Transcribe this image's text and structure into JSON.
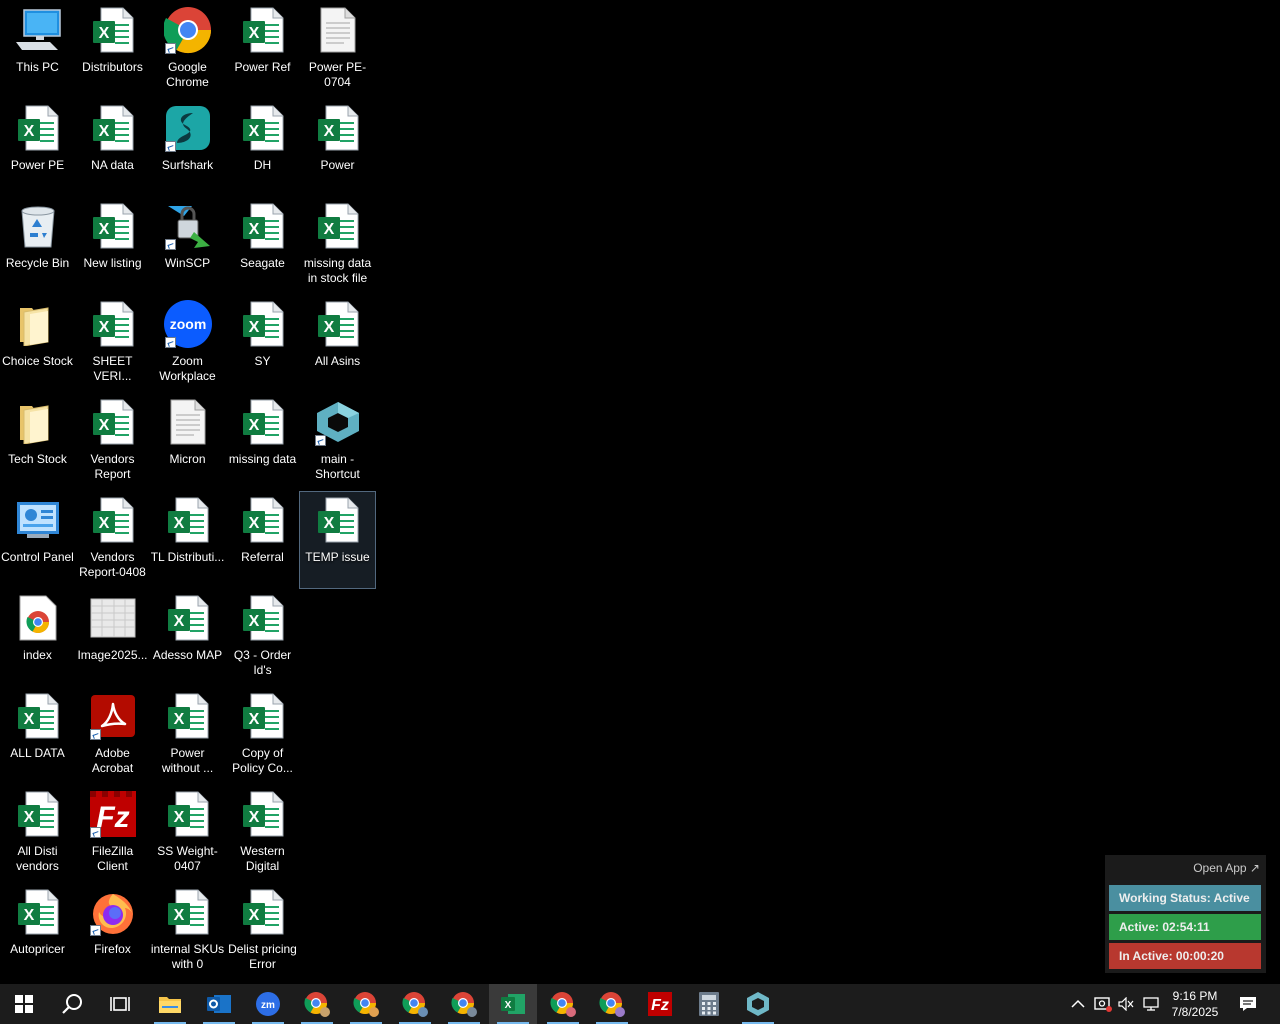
{
  "desktop": {
    "icons": [
      {
        "label": "This PC",
        "type": "pc",
        "shortcut": false
      },
      {
        "label": "Power PE",
        "type": "excel",
        "shortcut": false
      },
      {
        "label": "Recycle Bin",
        "type": "recycle",
        "shortcut": false
      },
      {
        "label": "Choice Stock",
        "type": "folder",
        "shortcut": false
      },
      {
        "label": "Tech Stock",
        "type": "folder",
        "shortcut": false
      },
      {
        "label": "Control Panel",
        "type": "control",
        "shortcut": false
      },
      {
        "label": "index",
        "type": "chromedoc",
        "shortcut": false
      },
      {
        "label": "ALL DATA",
        "type": "excel",
        "shortcut": false
      },
      {
        "label": "All Disti vendors",
        "type": "excel",
        "shortcut": false
      },
      {
        "label": "Autopricer",
        "type": "excel",
        "shortcut": false
      },
      {
        "label": "Distributors",
        "type": "excel",
        "shortcut": false
      },
      {
        "label": "NA data",
        "type": "excel",
        "shortcut": false
      },
      {
        "label": "New listing",
        "type": "excel",
        "shortcut": false
      },
      {
        "label": "SHEET VERI...",
        "type": "excel",
        "shortcut": false
      },
      {
        "label": "Vendors Report",
        "type": "excel",
        "shortcut": false
      },
      {
        "label": "Vendors Report-0408",
        "type": "excel",
        "shortcut": false
      },
      {
        "label": "Image2025...",
        "type": "image",
        "shortcut": false
      },
      {
        "label": "Adobe Acrobat",
        "type": "acrobat",
        "shortcut": true
      },
      {
        "label": "FileZilla Client",
        "type": "filezilla",
        "shortcut": true
      },
      {
        "label": "Firefox",
        "type": "firefox",
        "shortcut": true
      },
      {
        "label": "Google Chrome",
        "type": "chrome",
        "shortcut": true
      },
      {
        "label": "Surfshark",
        "type": "surfshark",
        "shortcut": true
      },
      {
        "label": "WinSCP",
        "type": "winscp",
        "shortcut": true
      },
      {
        "label": "Zoom Workplace",
        "type": "zoom",
        "shortcut": true
      },
      {
        "label": "Micron",
        "type": "doc",
        "shortcut": false
      },
      {
        "label": "TL Distributi...",
        "type": "excel",
        "shortcut": false
      },
      {
        "label": "Adesso MAP",
        "type": "excel",
        "shortcut": false
      },
      {
        "label": "Power without ...",
        "type": "excel",
        "shortcut": false
      },
      {
        "label": "SS Weight-0407",
        "type": "excel",
        "shortcut": false
      },
      {
        "label": "internal SKUs with 0",
        "type": "excel",
        "shortcut": false
      },
      {
        "label": "Power Ref",
        "type": "excel",
        "shortcut": false
      },
      {
        "label": "DH",
        "type": "excel",
        "shortcut": false
      },
      {
        "label": "Seagate",
        "type": "excel",
        "shortcut": false
      },
      {
        "label": "SY",
        "type": "excel",
        "shortcut": false
      },
      {
        "label": "missing data",
        "type": "excel",
        "shortcut": false
      },
      {
        "label": "Referral",
        "type": "excel",
        "shortcut": false
      },
      {
        "label": "Q3 - Order Id's",
        "type": "excel",
        "shortcut": false
      },
      {
        "label": "Copy of Policy Co...",
        "type": "excel",
        "shortcut": false
      },
      {
        "label": "Western Digital",
        "type": "excel",
        "shortcut": false
      },
      {
        "label": "Delist pricing Error",
        "type": "excel",
        "shortcut": false
      },
      {
        "label": "Power PE-0704",
        "type": "doc",
        "shortcut": false
      },
      {
        "label": "Power",
        "type": "excel",
        "shortcut": false
      },
      {
        "label": "missing data in stock file",
        "type": "excel",
        "shortcut": false
      },
      {
        "label": "All Asins",
        "type": "excel",
        "shortcut": false
      },
      {
        "label": "main - Shortcut",
        "type": "cube",
        "shortcut": true
      },
      {
        "label": "TEMP issue",
        "type": "excel",
        "shortcut": false,
        "selected": true
      }
    ]
  },
  "widget": {
    "open_app": "Open App ↗",
    "status": "Working Status: Active",
    "active": "Active: 02:54:11",
    "inactive": "In Active: 00:00:20",
    "colors": {
      "status": "#4a8fa0",
      "active": "#2e9e4a",
      "inactive": "#b8382f"
    }
  },
  "taskbar": {
    "apps": [
      "start",
      "search",
      "task-view",
      "file-explorer",
      "outlook",
      "zoom",
      "chrome-w",
      "chrome-profile-2",
      "chrome-profile-3",
      "chrome-profile-4",
      "excel",
      "chrome-profile-5",
      "chrome-profile-6",
      "filezilla",
      "calculator",
      "cube-app"
    ],
    "clock_time": "9:16 PM",
    "clock_date": "7/8/2025"
  }
}
